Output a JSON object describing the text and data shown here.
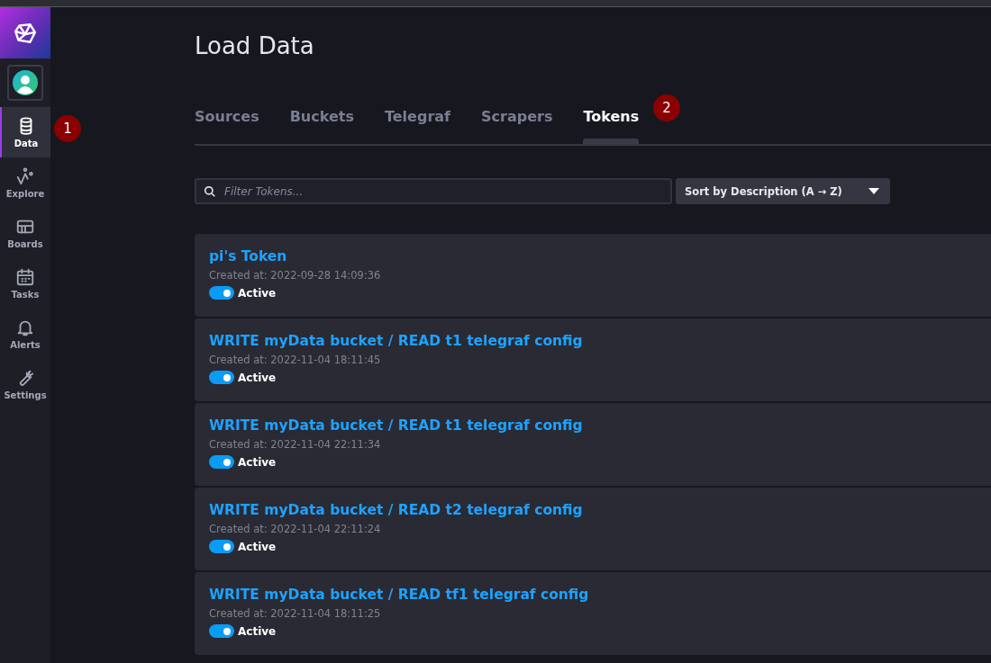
{
  "sidebar": {
    "items": [
      {
        "label": "Data",
        "kind": "database",
        "selected": true
      },
      {
        "label": "Explore",
        "kind": "graph",
        "selected": false
      },
      {
        "label": "Boards",
        "kind": "grid",
        "selected": false
      },
      {
        "label": "Tasks",
        "kind": "calendar",
        "selected": false
      },
      {
        "label": "Alerts",
        "kind": "bell",
        "selected": false
      },
      {
        "label": "Settings",
        "kind": "wrench",
        "selected": false
      }
    ]
  },
  "page": {
    "title": "Load Data"
  },
  "tabs": [
    {
      "label": "Sources",
      "selected": false
    },
    {
      "label": "Buckets",
      "selected": false
    },
    {
      "label": "Telegraf",
      "selected": false
    },
    {
      "label": "Scrapers",
      "selected": false
    },
    {
      "label": "Tokens",
      "selected": true
    }
  ],
  "annotations": [
    "1",
    "2"
  ],
  "filter": {
    "placeholder": "Filter Tokens..."
  },
  "sort": {
    "label": "Sort by Description (A → Z)"
  },
  "tokens": [
    {
      "name": "pi's Token",
      "created": "Created at: 2022-09-28 14:09:36",
      "status": "Active",
      "on": true
    },
    {
      "name": "WRITE myData bucket / READ t1 telegraf config",
      "created": "Created at: 2022-11-04 18:11:45",
      "status": "Active",
      "on": true
    },
    {
      "name": "WRITE myData bucket / READ t1 telegraf config",
      "created": "Created at: 2022-11-04 22:11:34",
      "status": "Active",
      "on": true
    },
    {
      "name": "WRITE myData bucket / READ t2 telegraf config",
      "created": "Created at: 2022-11-04 22:11:24",
      "status": "Active",
      "on": true
    },
    {
      "name": "WRITE myData bucket / READ tf1 telegraf config",
      "created": "Created at: 2022-11-04 18:11:25",
      "status": "Active",
      "on": true
    }
  ]
}
